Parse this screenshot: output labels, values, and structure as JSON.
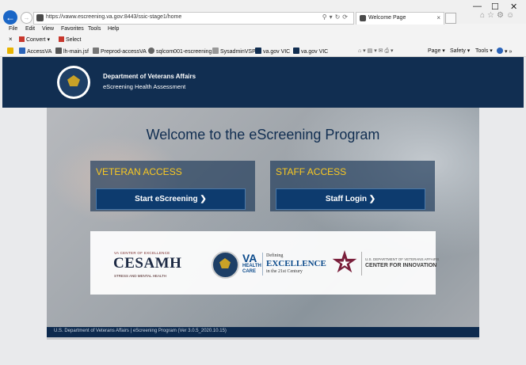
{
  "browser": {
    "url": "https://vaww.escreening.va.gov:8443/ssic-stage1/home",
    "tab_title": "Welcome Page",
    "menu": [
      "File",
      "Edit",
      "View",
      "Favorites",
      "Tools",
      "Help"
    ],
    "commands": {
      "close": "×",
      "convert": "Convert",
      "select": "Select"
    },
    "favorites": [
      "AccessVA",
      "lh-main.jsf",
      "Preprod-accessVA",
      "sqlcom001-escreening",
      "SysadminVSP",
      "va.gov VIC",
      "va.gov VIC"
    ],
    "command_tools": [
      "Page",
      "Safety",
      "Tools"
    ],
    "window_controls": {
      "minimize": "—",
      "restore": "☐",
      "close": "✕"
    }
  },
  "header": {
    "title": "Department of Veterans Affairs",
    "subtitle": "eScreening Health Assessment"
  },
  "hero": {
    "title": "Welcome to the eScreening Program"
  },
  "veteran_access": {
    "heading": "VETERAN ACCESS",
    "button": "Start eScreening ❯"
  },
  "staff_access": {
    "heading": "STAFF ACCESS",
    "button": "Staff Login ❯"
  },
  "partners": {
    "cesamh_top": "VA CENTER OF EXCELLENCE",
    "cesamh": "CESAMH",
    "cesamh_sub": "STRESS AND MENTAL HEALTH",
    "va": "VA",
    "va_health": "HEALTH",
    "va_care": "CARE",
    "defining": "Defining",
    "excellence": "EXCELLENCE",
    "century": "in the 21st Century",
    "innov_top": "U.S. DEPARTMENT OF VETERANS AFFAIRS",
    "innov_main": "CENTER FOR INNOVATION"
  },
  "footer": {
    "text": "U.S. Department of Veterans Affairs | eScreening Program (Ver 3.0.5_2020.10.15)"
  },
  "colors": {
    "navy": "#112e51",
    "gold": "#fac922",
    "button": "#0d3b6e"
  },
  "icons": [
    "back-arrow-icon",
    "forward-arrow-icon",
    "search-icon",
    "refresh-icon",
    "home-icon",
    "star-icon",
    "gear-icon",
    "smiley-icon"
  ]
}
